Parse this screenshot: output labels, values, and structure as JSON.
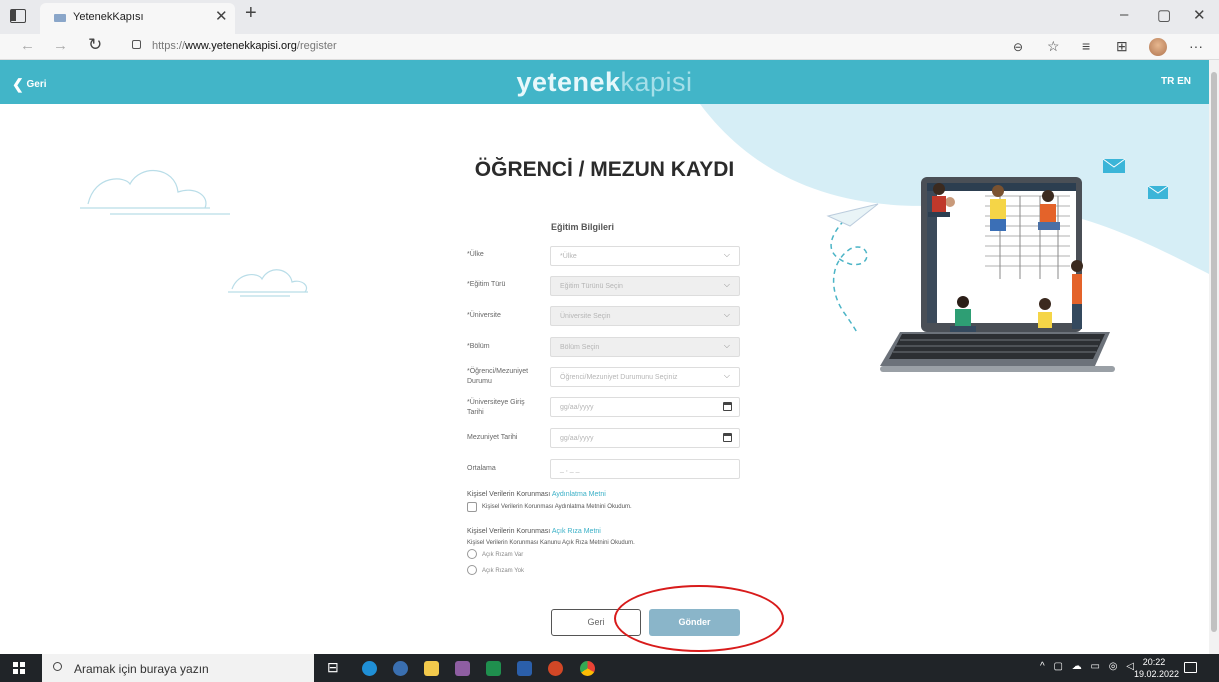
{
  "browser": {
    "tab_title": "YetenekKapısı",
    "url_prefix": "https://",
    "url_domain": "www.yetenekkapisi.org",
    "url_path": "/register",
    "window_buttons": [
      "–",
      "▢",
      "✕"
    ]
  },
  "header": {
    "back_label": "Geri",
    "logo_bold": "yetenek",
    "logo_light": "kapisi",
    "lang_tr": "TR",
    "lang_en": "EN",
    "color": "#42b5c8"
  },
  "title": "ÖĞRENCİ / MEZUN KAYDI",
  "form": {
    "section_title": "Eğitim Bilgileri",
    "country_label": "*Ülke",
    "country_placeholder": "*Ülke",
    "edu_type_label": "*Eğitim Türü",
    "edu_type_placeholder": "Eğitim Türünü Seçin",
    "university_label": "*Üniversite",
    "university_placeholder": "Üniversite Seçin",
    "department_label": "*Bölüm",
    "department_placeholder": "Bölüm Seçin",
    "status_label": "*Öğrenci/Mezuniyet Durumu",
    "status_placeholder": "Öğrenci/Mezuniyet Durumunu Seçiniz",
    "entry_date_label": "*Üniversiteye Giriş Tarihi",
    "entry_date_placeholder": "gg/aa/yyyy",
    "grad_date_label": "Mezuniyet Tarihi",
    "grad_date_placeholder": "gg/aa/yyyy",
    "gpa_label": "Ortalama",
    "gpa_placeholder": "_ , _ _"
  },
  "consent": {
    "kvkk_prefix": "Kişisel Verilerin Korunması",
    "kvkk_link": "Aydınlatma Metni",
    "kvkk_checkbox": "Kişisel Verilerin Korunması Aydınlatma Metnini Okudum.",
    "explicit_prefix": "Kişisel Verilerin Korunması",
    "explicit_link": "Açık Rıza Metni",
    "explicit_text": "Kişisel Verilerin Korunması Kanunu Açık Rıza Metnini Okudum.",
    "radio_yes": "Açık Rızam Var",
    "radio_no": "Açık Rızam Yok"
  },
  "buttons": {
    "back": "Geri",
    "submit": "Gönder",
    "submit_color": "#8ab5c9"
  },
  "taskbar": {
    "search_placeholder": "Aramak için buraya yazın",
    "time": "20:22",
    "date": "19.02.2022"
  },
  "icons": [
    "tab-actions-icon",
    "favicon-icon",
    "close-icon",
    "plus-icon",
    "back-arrow-icon",
    "forward-arrow-icon",
    "refresh-icon",
    "lock-icon",
    "zoom-icon",
    "favorite-icon",
    "favorites-list-icon",
    "collections-icon",
    "profile-icon",
    "more-icon",
    "chevron-left-icon",
    "chevron-down-icon",
    "calendar-icon",
    "windows-start-icon",
    "search-icon",
    "task-view-icon",
    "edge-icon",
    "file-explorer-icon",
    "word-icon",
    "excel-icon",
    "powerpoint-icon",
    "chrome-icon",
    "notification-icon"
  ]
}
